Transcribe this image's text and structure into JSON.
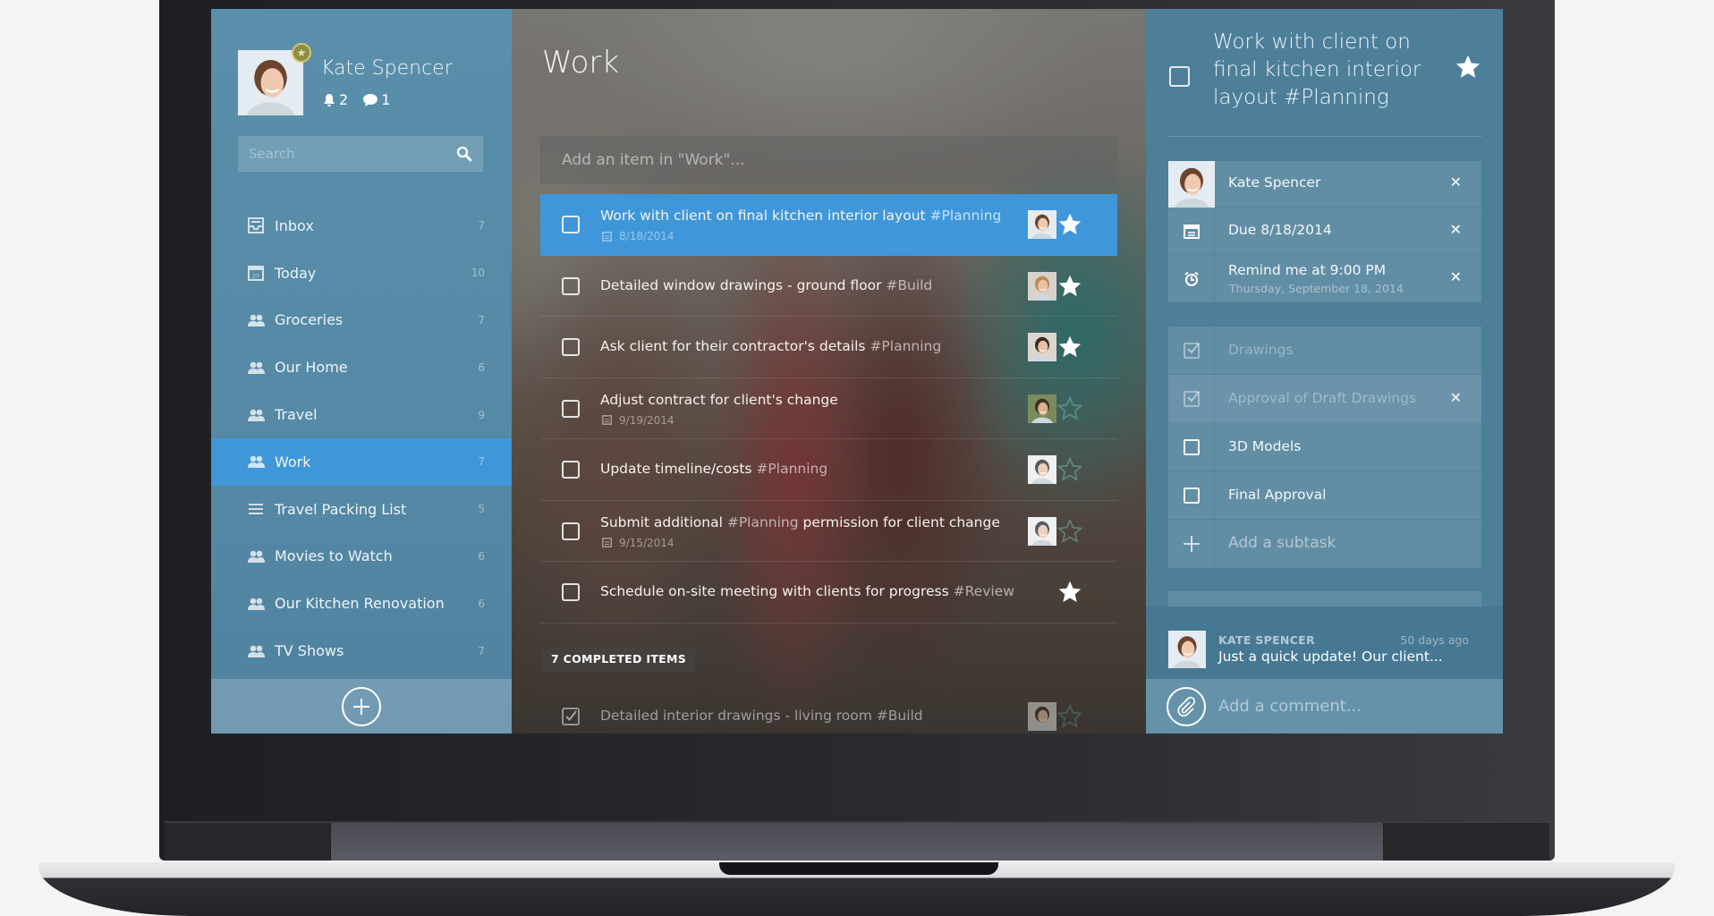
{
  "colors": {
    "sidebar": "#5589a6",
    "accent": "#3f97da",
    "detail": "#4d7f99"
  },
  "user": {
    "name": "Kate Spencer",
    "notifications": "2",
    "messages": "1",
    "avatar_icon": "avatar-woman"
  },
  "search": {
    "placeholder": "Search",
    "icon": "search-icon"
  },
  "sidebar": {
    "items": [
      {
        "label": "Inbox",
        "count": "7",
        "icon": "inbox"
      },
      {
        "label": "Today",
        "count": "10",
        "icon": "calendar"
      },
      {
        "label": "Groceries",
        "count": "7",
        "icon": "people"
      },
      {
        "label": "Our Home",
        "count": "6",
        "icon": "people"
      },
      {
        "label": "Travel",
        "count": "9",
        "icon": "people"
      },
      {
        "label": "Work",
        "count": "7",
        "icon": "people",
        "active": true
      },
      {
        "label": "Travel Packing List",
        "count": "5",
        "icon": "list"
      },
      {
        "label": "Movies to Watch",
        "count": "6",
        "icon": "people"
      },
      {
        "label": "Our Kitchen Renovation",
        "count": "6",
        "icon": "people"
      },
      {
        "label": "TV Shows",
        "count": "7",
        "icon": "people"
      }
    ],
    "add_icon": "plus-circle"
  },
  "main": {
    "title": "Work",
    "add_placeholder": "Add an item in \"Work\"...",
    "tasks": [
      {
        "text": "Work with client on final kitchen interior layout ",
        "tag": "#Planning",
        "after": "",
        "due": "8/18/2014",
        "starred": true,
        "selected": true,
        "avatar": "woman"
      },
      {
        "text": "Detailed window drawings - ground floor ",
        "tag": "#Build",
        "after": "",
        "due": "",
        "starred": true,
        "avatar": "man-blond"
      },
      {
        "text": "Ask client for their contractor's details ",
        "tag": "#Planning",
        "after": "",
        "due": "",
        "starred": true,
        "avatar": "woman-dark"
      },
      {
        "text": "Adjust contract for client's change",
        "tag": "",
        "after": "",
        "due": "9/19/2014",
        "starred": false,
        "avatar": "man-smile"
      },
      {
        "text": "Update timeline/costs ",
        "tag": "#Planning",
        "after": "",
        "due": "",
        "starred": false,
        "avatar": "man-beanie"
      },
      {
        "text": "Submit additional ",
        "tag": "#Planning",
        "after": " permission for client change",
        "due": "9/15/2014",
        "starred": false,
        "avatar": "man-beanie"
      },
      {
        "text": "Schedule on-site meeting with clients for progress ",
        "tag": "#Review",
        "after": "",
        "due": "",
        "starred": true,
        "avatar": ""
      }
    ],
    "completed_label": "7 COMPLETED ITEMS",
    "completed": [
      {
        "text": "Detailed interior drawings - living room #Build",
        "starred": false,
        "avatar": "woman-dark"
      }
    ]
  },
  "detail": {
    "title": "Work with client on final kitchen interior layout #Planning",
    "starred": true,
    "assignee": "Kate Spencer",
    "due": "Due 8/18/2014",
    "reminder": "Remind me at 9:00 PM",
    "reminder_date": "Thursday, September 18, 2014",
    "subtasks": [
      {
        "label": "Drawings",
        "done": true
      },
      {
        "label": "Approval of Draft Drawings",
        "done": true
      },
      {
        "label": "3D Models",
        "done": false
      },
      {
        "label": "Final Approval",
        "done": false
      }
    ],
    "add_subtask": "Add a subtask",
    "comment": {
      "author": "KATE SPENCER",
      "ago": "50 days ago",
      "text": "Just a quick update! Our client..."
    },
    "add_comment_placeholder": "Add a comment..."
  }
}
